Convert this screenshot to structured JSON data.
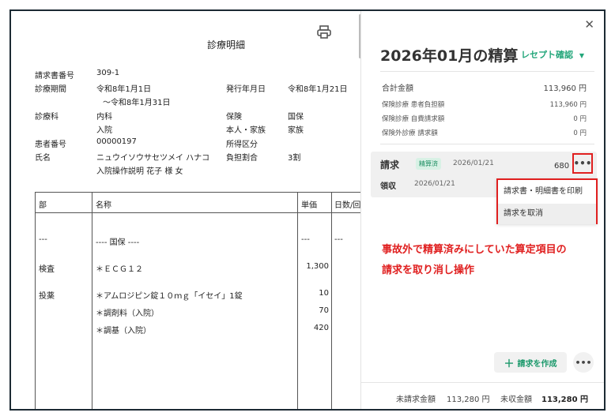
{
  "document": {
    "title": "診療明細",
    "fields": {
      "invoice_no_label": "請求書番号",
      "invoice_no": "309-1",
      "period_label": "診療期間",
      "period_from": "令和8年1月1日",
      "period_to": "～令和8年1月31日",
      "issue_label": "発行年月日",
      "issue_date": "令和8年1月21日",
      "dept_label": "診療科",
      "dept": "内科",
      "dept_sub": "入院",
      "insurance_label": "保険",
      "insurance": "国保",
      "holder_label": "本人・家族",
      "holder": "家族",
      "patient_no_label": "患者番号",
      "patient_no": "00000197",
      "income_label": "所得区分",
      "name_label": "氏名",
      "name_kana": "ニュウイソウサセツメイ ハナコ",
      "name": "入院操作説明 花子 様 女",
      "burden_label": "負担割合",
      "burden": "3割"
    },
    "table": {
      "headers": [
        "部",
        "名称",
        "単価",
        "日数/回"
      ],
      "rows": [
        {
          "dept": "---",
          "name": "---- 国保 ----",
          "price": "---",
          "days": "---"
        },
        {
          "dept": "検査",
          "name": "＊ＥＣＧ１２",
          "price": "1,300",
          "days": ""
        },
        {
          "dept": "投薬",
          "name": "＊アムロジピン錠１０ｍｇ「イセイ」1錠",
          "price": "10",
          "days": ""
        },
        {
          "dept": "",
          "name": "＊調剤料（入院）",
          "price": "70",
          "days": ""
        },
        {
          "dept": "",
          "name": "＊調基（入院）",
          "price": "420",
          "days": ""
        }
      ]
    }
  },
  "panel": {
    "title": "2026年01月の精算",
    "receipt_link": "レセプト確認",
    "summary": {
      "total_label": "合計金額",
      "total": "113,960 円",
      "ins_patient_label": "保険診療 患者負担額",
      "ins_patient": "113,960 円",
      "ins_self_label": "保険診療 自費請求額",
      "ins_self": "0 円",
      "non_ins_label": "保険外診療 請求額",
      "non_ins": "0 円"
    },
    "bill": {
      "label": "請求",
      "badge": "精算済",
      "date": "2026/01/21",
      "amount": "680 円",
      "receive_label": "領収",
      "receive_date": "2026/01/21"
    },
    "menu": {
      "print": "請求書・明細書を印刷",
      "cancel": "請求を取消"
    },
    "note_line1": "事故外で精算済みにしていた算定項目の",
    "note_line2": "請求を取り消し操作",
    "create_button": "請求を作成",
    "footer": {
      "unbilled_label": "未請求金額",
      "unbilled": "113,280 円",
      "unreceived_label": "未収金額",
      "unreceived": "113,280 円"
    }
  },
  "colors": {
    "accent": "#22a67a",
    "highlight": "#e02020"
  }
}
